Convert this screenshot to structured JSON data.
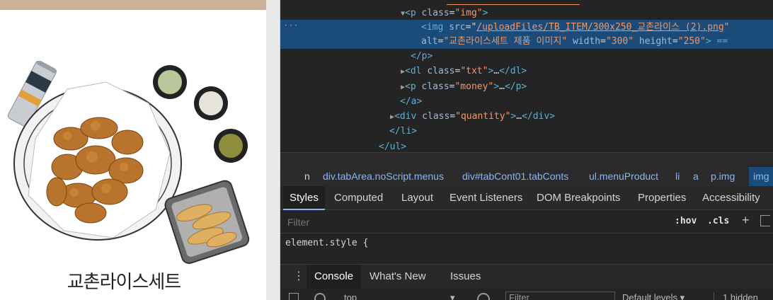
{
  "product": {
    "name": "교촌라이스세트",
    "image_alt": "교촌라이스세트 제품 이미지"
  },
  "elements_panel": {
    "gutter_dots": "···",
    "lines": {
      "p_open_tag": "p",
      "p_class_attr": "class",
      "p_class_val": "\"img\"",
      "img_tag": "img",
      "img_src_attr": "src",
      "img_src_val": "/uploadFiles/TB_ITEM/300x250_교촌라이스 (2).png",
      "img_alt_attr": "alt",
      "img_alt_val": "\"교촌라이스세트 제품 이미지\"",
      "img_width_attr": "width",
      "img_width_val": "\"300\"",
      "img_height_attr": "height",
      "img_height_val": "\"250\"",
      "img_tail": "> ==",
      "p_close": "</p>",
      "dl_class_val": "\"txt\"",
      "p_money_val": "\"money\"",
      "a_close": "</a>",
      "div_class_val": "\"quantity\"",
      "li_close": "</li>",
      "ul_close": "</ul>",
      "ellipsis": "…"
    }
  },
  "breadcrumbs": [
    {
      "label": "n"
    },
    {
      "label": "div.tabArea.noScript.menus"
    },
    {
      "label": "div#tabCont01.tabConts"
    },
    {
      "label": "ul.menuProduct"
    },
    {
      "label": "li"
    },
    {
      "label": "a"
    },
    {
      "label": "p.img"
    },
    {
      "label": "img"
    }
  ],
  "tabs": [
    {
      "label": "Styles",
      "active": true
    },
    {
      "label": "Computed"
    },
    {
      "label": "Layout"
    },
    {
      "label": "Event Listeners"
    },
    {
      "label": "DOM Breakpoints"
    },
    {
      "label": "Properties"
    },
    {
      "label": "Accessibility"
    }
  ],
  "styles": {
    "filter_placeholder": "Filter",
    "hov": ":hov",
    "cls": ".cls",
    "plus": "+",
    "element_style": "element.style {"
  },
  "drawer": {
    "menu_icon": "⋮",
    "tabs": [
      {
        "label": "Console",
        "active": true
      },
      {
        "label": "What's New"
      },
      {
        "label": "Issues"
      }
    ]
  },
  "console_bar": {
    "context": "top",
    "filter_placeholder": "Filter",
    "levels": "Default levels ▾",
    "hidden": "1 hidden"
  },
  "colors": {
    "devtools_bg": "#242424",
    "selection": "#1b4b79",
    "tag": "#5db0d7",
    "attr_value": "#f29766",
    "page_band": "#cbb197"
  }
}
